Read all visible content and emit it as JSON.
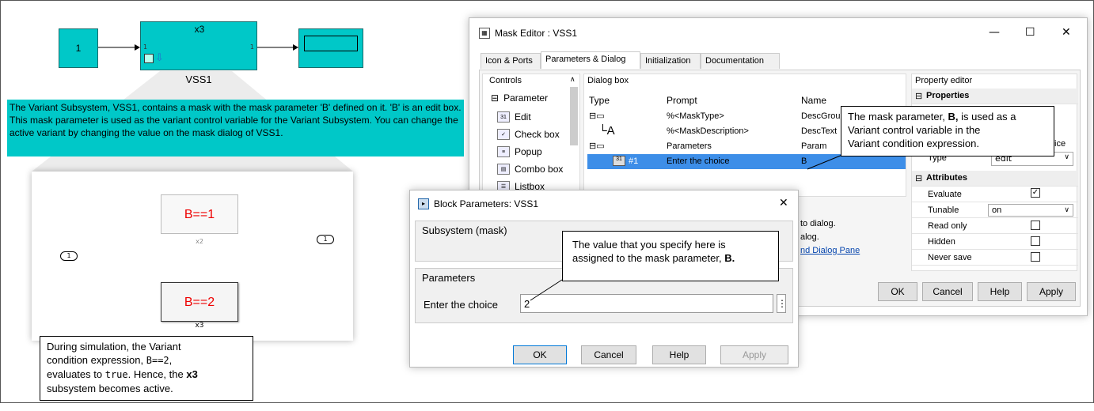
{
  "model": {
    "const_value": "1",
    "vss_title": "x3",
    "vss_label": "VSS1",
    "port_in": "1",
    "port_out": "1",
    "description": "The Variant Subsystem, VSS1, contains a mask with the  mask parameter 'B' defined on it. 'B' is an edit box. This mask parameter is used as the variant control variable for the Variant Subsystem. You can change the active variant by changing the value on the mask dialog of VSS1.",
    "inport_num": "1",
    "outport_num": "1",
    "variant1_label": "B==1",
    "variant1_name": "x2",
    "variant2_label": "B==2",
    "variant2_name": "x3"
  },
  "callout_sim": {
    "l1": "During simulation, the Variant",
    "l2a": "condition expression, ",
    "l2b": "B==2",
    "l2c": ",",
    "l3a": "evaluates to ",
    "l3b": "true",
    "l3c": ". Hence, the ",
    "l3d": "x3",
    "l4": "subsystem becomes active."
  },
  "mask_editor": {
    "title": "Mask Editor : VSS1",
    "tabs": [
      "Icon & Ports",
      "Parameters & Dialog",
      "Initialization",
      "Documentation"
    ],
    "controls_header": "Controls",
    "controls_group": "Parameter",
    "controls": [
      "Edit",
      "Check box",
      "Popup",
      "Combo box",
      "Listbox"
    ],
    "dialog_box_header": "Dialog box",
    "columns": [
      "Type",
      "Prompt",
      "Name"
    ],
    "rows": [
      {
        "prompt": "%<MaskType>",
        "name": "DescGrou"
      },
      {
        "prompt": "%<MaskDescription>",
        "name": "DescText"
      },
      {
        "prompt": "Parameters",
        "name": "Param"
      },
      {
        "num": "#1",
        "prompt": "Enter the choice",
        "name": "B"
      }
    ],
    "property_editor_header": "Property editor",
    "properties_label": "Properties",
    "attributes_label": "Attributes",
    "attributes": [
      "Evaluate",
      "Tunable",
      "Read only",
      "Hidden",
      "Never save"
    ],
    "tunable_value": "on",
    "partial_ice": "ice",
    "partial_type": "Type",
    "partial_edit": "edit",
    "help_text1": "to dialog.",
    "help_text2": "alog.",
    "help_link": "nd Dialog Pane",
    "buttons": [
      "OK",
      "Cancel",
      "Help",
      "Apply"
    ]
  },
  "callout_mask": {
    "l1a": "The mask parameter, ",
    "l1b": "B,",
    "l1c": " is used as a",
    "l2": "Variant control variable in the",
    "l3": "Variant condition expression."
  },
  "block_params": {
    "title": "Block Parameters: VSS1",
    "subsystem_label": "Subsystem (mask)",
    "parameters_label": "Parameters",
    "field_label": "Enter the choice",
    "field_value": "2",
    "buttons": [
      "OK",
      "Cancel",
      "Help",
      "Apply"
    ]
  },
  "callout_value": {
    "l1": "The value that you specify here is",
    "l2a": "assigned to the mask parameter, ",
    "l2b": "B."
  }
}
